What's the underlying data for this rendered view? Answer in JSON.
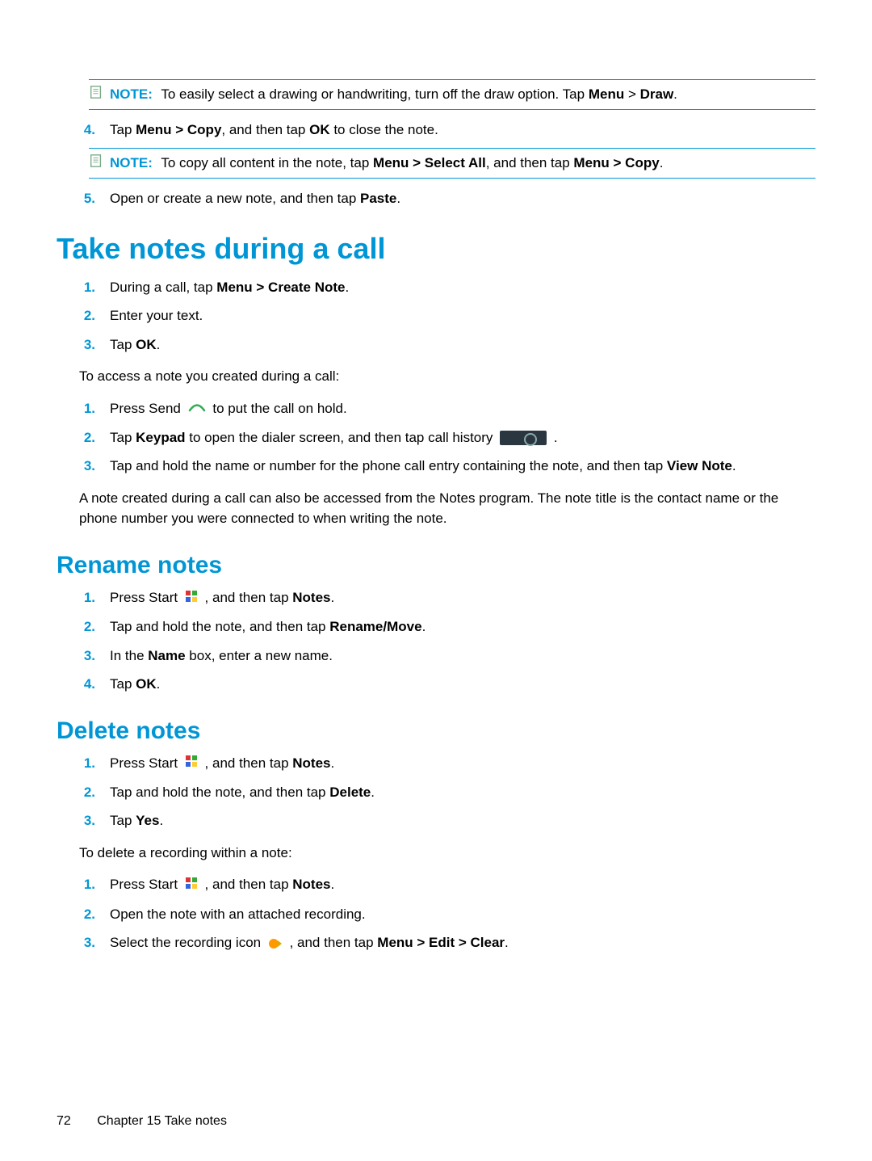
{
  "notes": {
    "n1": {
      "label": "NOTE:",
      "text_a": "To easily select a drawing or handwriting, turn off the draw option. Tap ",
      "menu": "Menu",
      "gt": " > ",
      "draw": "Draw",
      "period": "."
    },
    "n2": {
      "label": "NOTE:",
      "text_a": "To copy all content in the note, tap ",
      "b1": "Menu > Select All",
      "mid": ", and then tap ",
      "b2": "Menu > Copy",
      "period": "."
    }
  },
  "top_steps": {
    "s4": {
      "num": "4.",
      "pre": "Tap ",
      "bold": "Menu > Copy",
      "mid": ", and then tap ",
      "ok": "OK",
      "post": " to close the note."
    },
    "s5": {
      "num": "5.",
      "pre": "Open or create a new note, and then tap ",
      "bold": "Paste",
      "post": "."
    }
  },
  "sec_call": {
    "title": "Take notes during a call",
    "s1": {
      "num": "1.",
      "pre": "During a call, tap ",
      "bold": "Menu > Create Note",
      "post": "."
    },
    "s2": {
      "num": "2.",
      "text": "Enter your text."
    },
    "s3": {
      "num": "3.",
      "pre": "Tap ",
      "bold": "OK",
      "post": "."
    },
    "access": "To access a note you created during a call:",
    "a1": {
      "num": "1.",
      "pre": "Press Send ",
      "post": " to put the call on hold."
    },
    "a2": {
      "num": "2.",
      "pre": "Tap ",
      "bold": "Keypad",
      "mid": " to open the dialer screen, and then tap call history ",
      "post": "."
    },
    "a3": {
      "num": "3.",
      "pre": "Tap and hold the name or number for the phone call entry containing the note, and then tap ",
      "bold": "View Note",
      "post": "."
    },
    "foot": "A note created during a call can also be accessed from the Notes program. The note title is the contact name or the phone number you were connected to when writing the note."
  },
  "sec_rename": {
    "title": "Rename notes",
    "s1": {
      "num": "1.",
      "pre": "Press Start ",
      "mid": ", and then tap ",
      "bold": "Notes",
      "post": "."
    },
    "s2": {
      "num": "2.",
      "pre": "Tap and hold the note, and then tap ",
      "bold": "Rename/Move",
      "post": "."
    },
    "s3": {
      "num": "3.",
      "pre": "In the ",
      "bold": "Name",
      "post": " box, enter a new name."
    },
    "s4": {
      "num": "4.",
      "pre": "Tap ",
      "bold": "OK",
      "post": "."
    }
  },
  "sec_delete": {
    "title": "Delete notes",
    "s1": {
      "num": "1.",
      "pre": "Press Start ",
      "mid": ", and then tap ",
      "bold": "Notes",
      "post": "."
    },
    "s2": {
      "num": "2.",
      "pre": "Tap and hold the note, and then tap ",
      "bold": "Delete",
      "post": "."
    },
    "s3": {
      "num": "3.",
      "pre": "Tap ",
      "bold": "Yes",
      "post": "."
    },
    "foot": "To delete a recording within a note:",
    "d1": {
      "num": "1.",
      "pre": "Press Start ",
      "mid": ", and then tap ",
      "bold": "Notes",
      "post": "."
    },
    "d2": {
      "num": "2.",
      "text": "Open the note with an attached recording."
    },
    "d3": {
      "num": "3.",
      "pre": "Select the recording icon ",
      "mid": ", and then tap ",
      "bold": "Menu > Edit > Clear",
      "post": "."
    }
  },
  "footer": {
    "page": "72",
    "chapter": "Chapter 15   Take notes"
  }
}
